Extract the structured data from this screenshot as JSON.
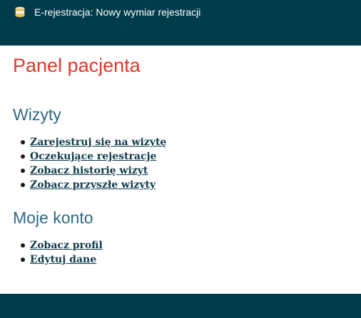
{
  "header": {
    "title": "E-rejestracja: Nowy wymiar rejestracji",
    "icon": "stack-of-coins-icon"
  },
  "page_title": "Panel pacjenta",
  "visits": {
    "heading": "Wizyty",
    "links": [
      "Zarejestruj się na wizytę",
      "Oczekujące rejestracje",
      "Zobacz historię wizyt",
      "Zobacz przyszłe wizyty"
    ]
  },
  "account": {
    "heading": "Moje konto",
    "links": [
      "Zobacz profil",
      "Edytuj dane"
    ]
  },
  "colors": {
    "header_bg": "#003c4c",
    "page_title": "#e5362a",
    "section_heading": "#2d6a85",
    "link": "#0f3a4c"
  }
}
